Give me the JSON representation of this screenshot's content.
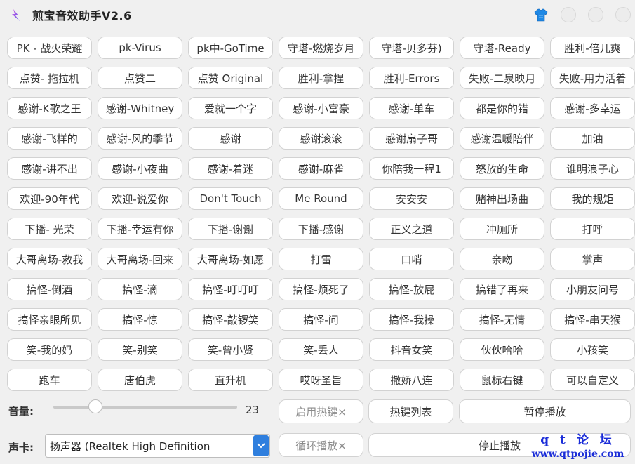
{
  "window": {
    "title": "煎宝音效助手V2.6"
  },
  "sound_buttons": [
    "PK - 战火荣耀",
    "pk-Virus",
    "pk中-GoTime",
    "守塔-燃烧岁月",
    "守塔-贝多芬)",
    "守塔-Ready",
    "胜利-倍儿爽",
    "点赞- 拖拉机",
    "点赞二",
    "点赞 Original",
    "胜利-拿捏",
    "胜利-Errors",
    "失败-二泉映月",
    "失败-用力活着",
    "感谢-K歌之王",
    "感谢-Whitney",
    "爱就一个字",
    "感谢-小富豪",
    "感谢-单车",
    "都是你的错",
    "感谢-多幸运",
    "感谢-飞样的",
    "感谢-风的季节",
    "感谢",
    "感谢滚滚",
    "感谢扇子哥",
    "感谢温暖陪伴",
    "加油",
    "感谢-讲不出",
    "感谢-小夜曲",
    "感谢-着迷",
    "感谢-麻雀",
    "你陪我一程1",
    "怒放的生命",
    "谁明浪子心",
    "欢迎-90年代",
    "欢迎-说爱你",
    "Don't Touch",
    "Me Round",
    "安安安",
    "赌神出场曲",
    "我的规矩",
    "下播- 光荣",
    "下播-幸运有你",
    "下播-谢谢",
    "下播-感谢",
    "正义之道",
    "冲厕所",
    "打呼",
    "大哥离场-救我",
    "大哥离场-回来",
    "大哥离场-如愿",
    "打雷",
    "口哨",
    "亲吻",
    "掌声",
    "搞怪-倒酒",
    "搞怪-滴",
    "搞怪-叮叮叮",
    "搞怪-烦死了",
    "搞怪-放屁",
    "搞错了再来",
    "小朋友问号",
    "搞怪亲眼所见",
    "搞怪-惊",
    "搞怪-敲锣笑",
    "搞怪-问",
    "搞怪-我操",
    "搞怪-无情",
    "搞怪-串天猴",
    "笑-我的妈",
    "笑-别笑",
    "笑-曾小贤",
    "笑-丢人",
    "抖音女笑",
    "伙伙哈哈",
    "小孩笑",
    "跑车",
    "唐伯虎",
    "直升机",
    "哎呀圣旨",
    "撒娇八连",
    "鼠标右键",
    "可以自定义"
  ],
  "volume": {
    "label": "音量:",
    "value": "23",
    "level": 0.23
  },
  "soundcard": {
    "label": "声卡:",
    "selected": "扬声器 (Realtek High Definition"
  },
  "controls": {
    "enable_hotkey": "启用热键×",
    "hotkey_list": "热键列表",
    "pause": "暂停播放",
    "loop": "循环播放×",
    "stop": "停止播放"
  },
  "watermark": {
    "line1": "q t 论 坛",
    "line2": "www.qtpojie.com"
  },
  "colors": {
    "accent": "#2f7fde",
    "skin_icon": "#1e88e5",
    "watermark": "#1a2cd8"
  },
  "icons": {
    "app": "music-note-icon",
    "skin": "shirt-icon",
    "dropdown": "chevron-down-icon"
  }
}
